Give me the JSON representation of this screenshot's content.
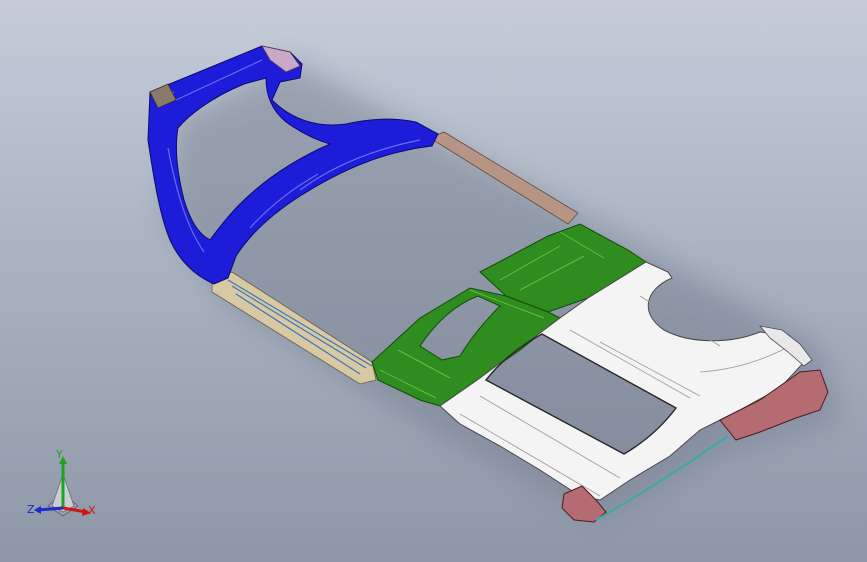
{
  "view": {
    "title": "",
    "background_top": "#c5ccd8",
    "background_bottom": "#8e97a7"
  },
  "model": {
    "name": "",
    "part_colors": {
      "front_frame": "#1c1cd9",
      "mid_panels": "#2f8c1e",
      "rear_panel": "#f4f4f4",
      "rear_frame": "#b56b72",
      "side_rail": "#d8c8a3",
      "rail_strip": "#b89484"
    }
  },
  "triad": {
    "y_label": "Y",
    "z_label": "Z",
    "x_label": "X",
    "y_color": "#1fa31f",
    "z_color": "#1a2bd0",
    "x_color": "#d01515"
  }
}
